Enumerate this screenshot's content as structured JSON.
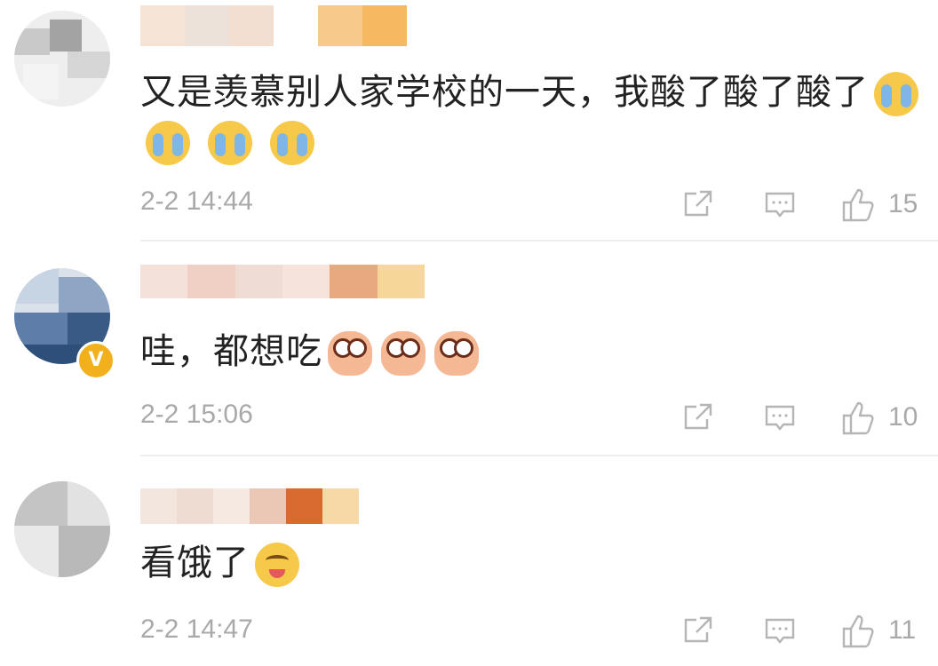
{
  "comments": [
    {
      "text": "又是羡慕别人家学校的一天，我酸了酸了酸了",
      "emojis": [
        "crying-emoji",
        "crying-emoji",
        "crying-emoji",
        "crying-emoji"
      ],
      "time": "2-2 14:44",
      "likes": "15",
      "verified": false
    },
    {
      "text": "哇，都想吃",
      "emojis": [
        "praying-eyes-emoji",
        "praying-eyes-emoji",
        "praying-eyes-emoji"
      ],
      "time": "2-2 15:06",
      "likes": "10",
      "verified": true
    },
    {
      "text": "看饿了",
      "emojis": [
        "drooling-emoji"
      ],
      "time": "2-2 14:47",
      "likes": "11",
      "verified": false
    }
  ],
  "icons": {
    "repost": "repost-icon",
    "reply": "reply-icon",
    "like": "thumbs-up-icon"
  },
  "colors": {
    "text": "#222222",
    "meta": "#a9a9a9",
    "divider": "#eeeeee",
    "verified_badge": "#f2b11c"
  }
}
